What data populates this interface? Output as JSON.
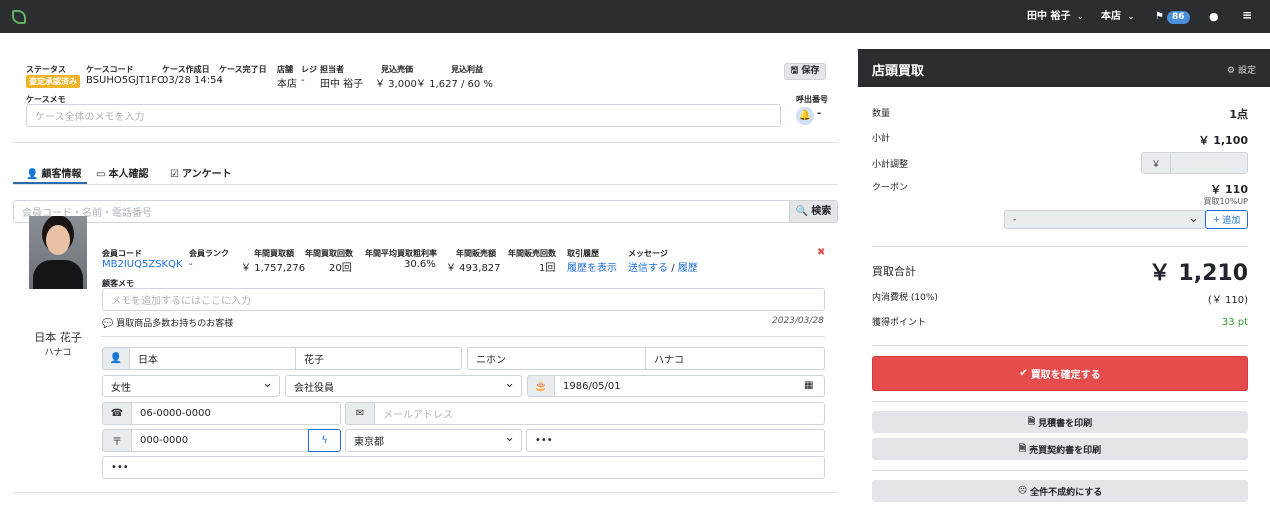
{
  "topbar": {
    "user_name": "田中 裕子",
    "store": "本店",
    "flag_count": "86"
  },
  "case": {
    "status_label": "ステータス",
    "status_value": "査定承認済み",
    "code_label": "ケースコード",
    "code_value": "BSUHO5GJT1FC",
    "created_label": "ケース作成日",
    "created_value": "03/28 14:54",
    "completed_label": "ケース完了日",
    "completed_value": "-",
    "store_label": "店舗",
    "store_value": "本店",
    "register_label": "レジ",
    "register_value": "-",
    "staff_label": "担当者",
    "staff_value": "田中 裕子",
    "est_price_label": "見込売価",
    "est_price_value": "￥ 3,000",
    "est_profit_label": "見込利益",
    "est_profit_value": "￥ 1,627 / 60 %",
    "save_label": "保存",
    "memo_label": "ケースメモ",
    "memo_placeholder": "ケース全体のメモを入力",
    "call_label": "呼出番号",
    "call_value": "-"
  },
  "tabs": [
    {
      "label": "顧客情報"
    },
    {
      "label": "本人確認"
    },
    {
      "label": "アンケート"
    }
  ],
  "search": {
    "placeholder": "会員コード・名前・電話番号",
    "button_label": "検索"
  },
  "customer": {
    "name": "日本 花子",
    "kana": "ハナコ",
    "member_code_label": "会員コード",
    "member_code": "MB2IUQ5ZSKQK",
    "rank_label": "会員ランク",
    "rank": "-",
    "annual_buy_label": "年間買取額",
    "annual_buy": "￥ 1,757,276",
    "annual_buy_count_label": "年間買取回数",
    "annual_buy_count": "20回",
    "avg_rate_label": "年間平均買取粗利率",
    "avg_rate": "30.6%",
    "annual_sales_label": "年間販売額",
    "annual_sales": "￥ 493,827",
    "annual_sales_count_label": "年間販売回数",
    "annual_sales_count": "1回",
    "history_label": "取引履歴",
    "history_link": "履歴を表示",
    "message_label": "メッセージ",
    "message_send": "送信する",
    "message_sep": "/",
    "message_history": "履歴",
    "memo_label": "顧客メモ",
    "memo_placeholder": "メモを追加するにはここに入力",
    "comment": "買取商品多数お持ちのお客様",
    "comment_date": "2023/03/28"
  },
  "form": {
    "last_name": "日本",
    "first_name": "花子",
    "last_kana": "ニホン",
    "first_kana": "ハナコ",
    "gender": "女性",
    "occupation": "会社役員",
    "birthday": "1986/05/01",
    "phone": "06-0000-0000",
    "email_placeholder": "メールアドレス",
    "postal_symbol": "〒",
    "postal": "000-0000",
    "prefecture": "東京都",
    "address1": "•••",
    "address2": "•••"
  },
  "panel": {
    "title": "店頭買取",
    "settings_label": "設定",
    "qty_label": "数量",
    "qty_value": "1点",
    "subtotal_label": "小計",
    "subtotal_value": "￥ 1,100",
    "adjust_label": "小計調整",
    "yen_symbol": "￥",
    "coupon_label": "クーポン",
    "coupon_value": "￥ 110",
    "coupon_note": "買取10%UP",
    "coupon_select": "-",
    "add_label": "追加",
    "total_label": "買取合計",
    "total_value": "￥ 1,210",
    "tax_label": "内消費税 (10%)",
    "tax_value": "(￥ 110)",
    "points_label": "獲得ポイント",
    "points_value": "33 pt",
    "confirm_label": "買取を確定する",
    "print_estimate": "見積書を印刷",
    "print_contract": "売買契約書を印刷",
    "cancel_all": "全件不成約にする"
  },
  "colors": {
    "topbar": "#2b2d31",
    "accent_red": "#e74c4c",
    "status_yellow": "#f0b429",
    "link_blue": "#1e6fd9",
    "points_green": "#3a9a3a"
  }
}
